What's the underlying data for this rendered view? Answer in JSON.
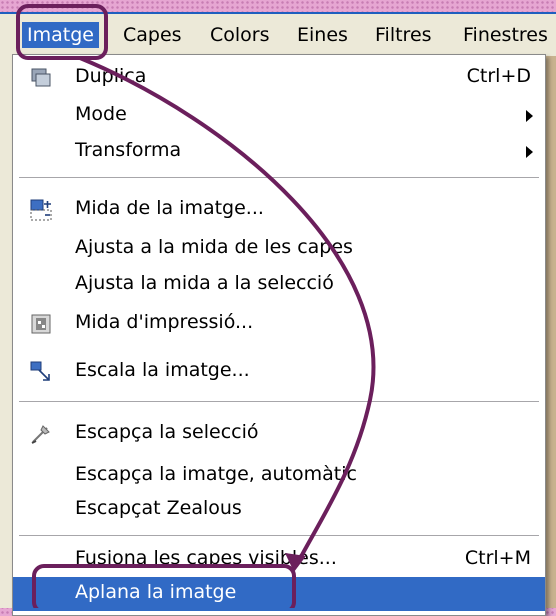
{
  "menubar": {
    "items": [
      {
        "label": "Imatge"
      },
      {
        "label": "Capes"
      },
      {
        "label": "Colors"
      },
      {
        "label": "Eines"
      },
      {
        "label": "Filtres"
      },
      {
        "label": "Finestres"
      }
    ]
  },
  "menu": {
    "items": [
      {
        "label": "Duplica",
        "shortcut": "Ctrl+D",
        "icon": "duplicate-icon"
      },
      {
        "label": "Mode",
        "submenu": true
      },
      {
        "label": "Transforma",
        "submenu": true
      },
      {
        "label": "Mida de la imatge...",
        "icon": "canvas-size-icon"
      },
      {
        "label": "Ajusta a la mida de les capes"
      },
      {
        "label": "Ajusta la mida a la selecció"
      },
      {
        "label": "Mida d'impressió...",
        "icon": "print-size-icon"
      },
      {
        "label": "Escala la imatge...",
        "icon": "scale-icon"
      },
      {
        "label": "Escapça la selecció",
        "icon": "crop-icon"
      },
      {
        "label": "Escapça la imatge, automàtic"
      },
      {
        "label": "Escapçat Zealous"
      },
      {
        "label": "Fusiona les capes visibles...",
        "shortcut": "Ctrl+M"
      },
      {
        "label": "Aplana la imatge",
        "highlighted": true
      }
    ]
  },
  "colors": {
    "highlight": "#316ac5",
    "annotation": "#6b1f5c"
  }
}
